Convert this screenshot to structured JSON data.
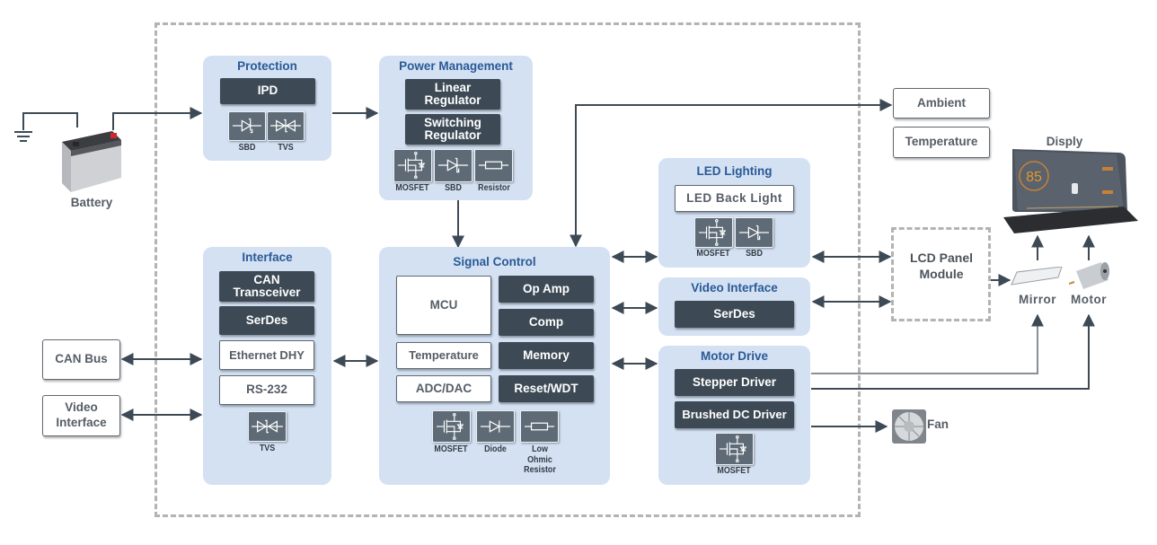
{
  "external_left": {
    "battery_label": "Battery",
    "can_bus": "CAN Bus",
    "video_interface": "Video Interface"
  },
  "groups": {
    "protection": {
      "title": "Protection",
      "blocks": [
        "IPD"
      ],
      "components": [
        "SBD",
        "TVS"
      ]
    },
    "power_management": {
      "title": "Power Management",
      "blocks": [
        "Linear Regulator",
        "Switching Regulator"
      ],
      "components": [
        "MOSFET",
        "SBD",
        "Resistor"
      ]
    },
    "interface": {
      "title": "Interface",
      "blocks": [
        "CAN Transceiver",
        "SerDes",
        "Ethernet DHY",
        "RS-232"
      ],
      "components": [
        "TVS"
      ]
    },
    "signal_control": {
      "title": "Signal Control",
      "blocks": [
        "MCU",
        "Op Amp",
        "Comp",
        "Temperature",
        "Memory",
        "ADC/DAC",
        "Reset/WDT"
      ],
      "components": [
        "MOSFET",
        "Diode",
        "Low Ohmic Resistor"
      ]
    },
    "led_lighting": {
      "title": "LED Lighting",
      "blocks": [
        "LED Back Light"
      ],
      "components": [
        "MOSFET",
        "SBD"
      ]
    },
    "video_interface": {
      "title": "Video Interface",
      "blocks": [
        "SerDes"
      ]
    },
    "motor_drive": {
      "title": "Motor Drive",
      "blocks": [
        "Stepper Driver",
        "Brushed DC Driver"
      ],
      "components": [
        "MOSFET"
      ]
    }
  },
  "external_right": {
    "ambient": "Ambient",
    "temperature": "Temperature",
    "display_label": "Disply",
    "display_speed": "85",
    "lcd_panel": "LCD Panel Module",
    "mirror": "Mirror",
    "motor": "Motor",
    "fan": "Fan"
  },
  "colors": {
    "group_bg": "#d3e1f3",
    "group_title": "#2a5a96",
    "dark_block": "#3d4a55",
    "wire": "#3d4a55",
    "dashed_frame": "#b3b3b3"
  }
}
